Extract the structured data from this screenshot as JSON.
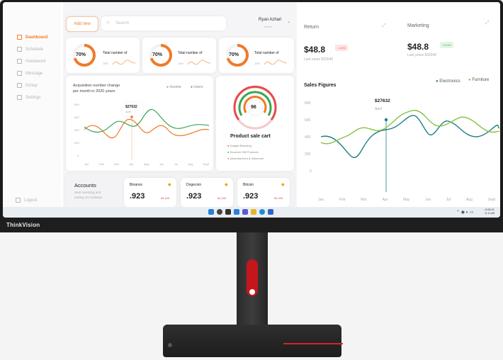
{
  "brand": "ThinkVision",
  "sidebar": {
    "items": [
      {
        "label": "Dashboard",
        "active": true
      },
      {
        "label": "Schedule"
      },
      {
        "label": "Homework"
      },
      {
        "label": "Message"
      },
      {
        "label": "Group"
      },
      {
        "label": "Settings"
      }
    ],
    "logout": "Logout"
  },
  "header": {
    "add_button": "Add new",
    "search_placeholder": "Search",
    "user_name": "Ryan Azhari",
    "user_role": "Admin"
  },
  "stat_cards": [
    {
      "percent": "70%",
      "label": "Total number of",
      "sub": "15%"
    },
    {
      "percent": "70%",
      "label": "Total number of",
      "sub": "15%"
    },
    {
      "percent": "70%",
      "label": "Total number of",
      "sub": "15%"
    }
  ],
  "acq_chart": {
    "title_line1": "Acquisition number change",
    "title_line2": "per month in 2020 years",
    "legend": [
      "Income",
      "Users"
    ],
    "tooltip_value": "$27632",
    "tooltip_month": "April",
    "y_ticks": [
      "800",
      "600",
      "400",
      "200",
      "0"
    ],
    "x_ticks": [
      "Jan",
      "Feb",
      "Mar",
      "Apr",
      "May",
      "Jun",
      "Jul",
      "Aug",
      "Sept"
    ]
  },
  "product_cart": {
    "gauge_value": "96",
    "title": "Product sale cart",
    "legend": [
      "Gadget Branding",
      "Souvenir Gift Products",
      "Advertisement & Influencer"
    ]
  },
  "accounts": {
    "title": "Accounts",
    "desc_line1": "Start investing and",
    "desc_line2": "trading on coinbase",
    "coins": [
      {
        "name": "Binance",
        "value": ".923",
        "change": "$4,345"
      },
      {
        "name": "Dogecoin",
        "value": ".923",
        "change": "$4,345"
      },
      {
        "name": "Bitcoin",
        "value": ".923",
        "change": "$4,345"
      }
    ]
  },
  "return_card": {
    "title": "Return",
    "amount": "$48.8",
    "badge": "-3.4%",
    "sub": "Last years $32640"
  },
  "marketing_card": {
    "title": "Marketing",
    "amount": "$48.8",
    "badge": "+4.4%",
    "sub": "Last years $32640"
  },
  "sales": {
    "title": "Sales Figures",
    "legend": [
      "Electronics",
      "Furniture"
    ],
    "tooltip_value": "$27632",
    "tooltip_month": "April",
    "y_ticks": [
      "800",
      "600",
      "400",
      "200",
      "0"
    ],
    "x_ticks": [
      "Jan",
      "Feb",
      "Mar",
      "Apr",
      "May",
      "Jun",
      "Jul",
      "Aug",
      "Sept"
    ]
  },
  "taskbar": {
    "time": "10:59:22",
    "date": "11:11 AM"
  },
  "colors": {
    "accent": "#f07a2a",
    "green": "#86c23e",
    "teal": "#1f7f86",
    "red": "#e64b4b"
  }
}
